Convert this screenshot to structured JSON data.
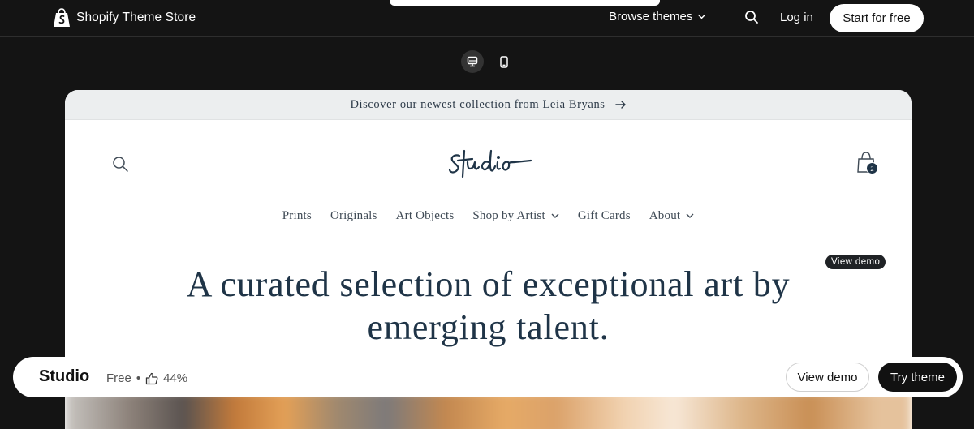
{
  "header": {
    "brand": "Shopify Theme Store",
    "browse_label": "Browse themes",
    "login_label": "Log in",
    "start_label": "Start for free"
  },
  "preview": {
    "announcement": "Discover our newest collection from Leia Bryans",
    "cart_count": "2",
    "nav": [
      {
        "label": "Prints",
        "dropdown": false
      },
      {
        "label": "Originals",
        "dropdown": false
      },
      {
        "label": "Art Objects",
        "dropdown": false
      },
      {
        "label": "Shop by Artist",
        "dropdown": true
      },
      {
        "label": "Gift Cards",
        "dropdown": false
      },
      {
        "label": "About",
        "dropdown": true
      }
    ],
    "view_demo_badge": "View demo",
    "hero_line1": "A curated selection of exceptional art by",
    "hero_line2": "emerging talent."
  },
  "theme_bar": {
    "name": "Studio",
    "price": "Free",
    "separator": "•",
    "rating": "44%",
    "view_demo_label": "View demo",
    "try_label": "Try theme"
  },
  "colors": {
    "page_bg": "#141414",
    "store_text": "#1f3447",
    "button_dark": "#111111"
  },
  "icons": [
    "shopify-bag-icon",
    "chevron-down-icon",
    "search-icon",
    "desktop-icon",
    "mobile-icon",
    "arrow-right-icon",
    "cart-icon",
    "thumbs-up-icon"
  ]
}
